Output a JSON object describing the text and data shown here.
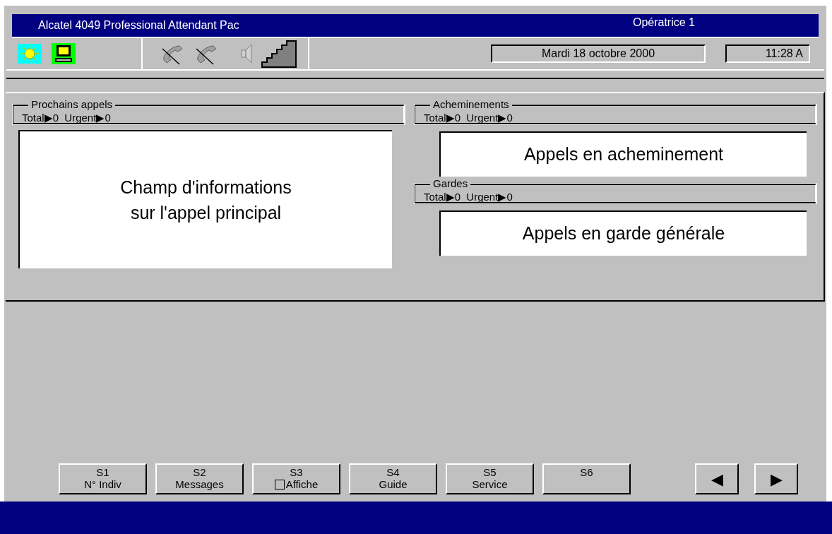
{
  "window": {
    "title": "Alcatel 4049 Professional Attendant Pac",
    "operator": "Opératrice 1"
  },
  "status": {
    "date": "Mardi 18 octobre 2000",
    "time": "11:28 A"
  },
  "left_panel": {
    "title": "Prochains appels",
    "counts": "Total▶0  Urgent▶0",
    "field": [
      "Champ d'informations",
      "sur l'appel principal"
    ]
  },
  "right_panels": [
    {
      "title": "Acheminements",
      "counts": "Total▶0  Urgent▶0",
      "field": "Appels en acheminement"
    },
    {
      "title": "Gardes",
      "counts": "Total▶0  Urgent▶0",
      "field": "Appels en garde générale"
    }
  ],
  "softkeys": [
    {
      "key": "S1",
      "label": "N° Indiv"
    },
    {
      "key": "S2",
      "label": "Messages"
    },
    {
      "key": "S3",
      "label": "Affiche",
      "checked": false
    },
    {
      "key": "S4",
      "label": "Guide"
    },
    {
      "key": "S5",
      "label": "Service"
    },
    {
      "key": "S6"
    }
  ],
  "nav_buttons": [
    "◀",
    "▶"
  ]
}
